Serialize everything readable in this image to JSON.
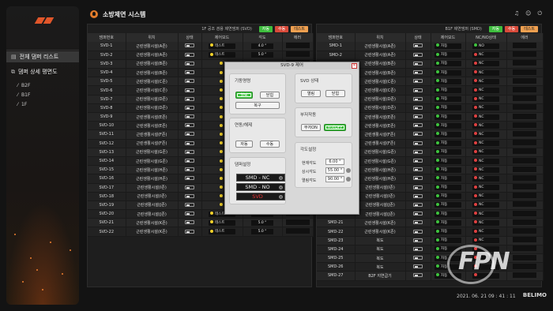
{
  "app": {
    "title": "소방제연 시스템"
  },
  "sidebar": {
    "items": [
      {
        "label": "전체 댐퍼 리스트"
      },
      {
        "label": "댐퍼 상세 평면도"
      }
    ],
    "floors": [
      "B2F",
      "B1F",
      "1F"
    ]
  },
  "left_panel": {
    "title": "1F 공조 겸용 제연댐퍼 (SVD)",
    "btn_auto": "자동",
    "btn_manual": "수동",
    "btn_test": "테스트",
    "headers": [
      "댐퍼번호",
      "위치",
      "상태",
      "제어모드",
      "각도",
      "에러"
    ],
    "rows": [
      {
        "id": "SVD-1",
        "loc": "근린생활시설(A존)",
        "mode": "테스트",
        "angle": "4.0 °"
      },
      {
        "id": "SVD-2",
        "loc": "근린생활시설(A존)",
        "mode": "테스트",
        "angle": "5.0 °"
      },
      {
        "id": "SVD-3",
        "loc": "근린생활시설(B존)",
        "mode": "",
        "angle": ""
      },
      {
        "id": "SVD-4",
        "loc": "근린생활시설(B존)",
        "mode": "",
        "angle": ""
      },
      {
        "id": "SVD-5",
        "loc": "근린생활시설(C존)",
        "mode": "",
        "angle": ""
      },
      {
        "id": "SVD-6",
        "loc": "근린생활시설(C존)",
        "mode": "",
        "angle": ""
      },
      {
        "id": "SVD-7",
        "loc": "근린생활시설(D존)",
        "mode": "",
        "angle": ""
      },
      {
        "id": "SVD-8",
        "loc": "근린생활시설(D존)",
        "mode": "",
        "angle": ""
      },
      {
        "id": "SVD-9",
        "loc": "근린생활시설(E존)",
        "mode": "",
        "angle": ""
      },
      {
        "id": "SVD-10",
        "loc": "근린생활시설(E존)",
        "mode": "",
        "angle": ""
      },
      {
        "id": "SVD-11",
        "loc": "근린생활시설(F존)",
        "mode": "",
        "angle": ""
      },
      {
        "id": "SVD-12",
        "loc": "근린생활시설(F존)",
        "mode": "",
        "angle": ""
      },
      {
        "id": "SVD-13",
        "loc": "근린생활시설(G존)",
        "mode": "",
        "angle": ""
      },
      {
        "id": "SVD-14",
        "loc": "근린생활시설(G존)",
        "mode": "",
        "angle": ""
      },
      {
        "id": "SVD-15",
        "loc": "근린생활시설(H존)",
        "mode": "",
        "angle": ""
      },
      {
        "id": "SVD-16",
        "loc": "근린생활시설(H존)",
        "mode": "",
        "angle": ""
      },
      {
        "id": "SVD-17",
        "loc": "근린생활시설(I존)",
        "mode": "",
        "angle": ""
      },
      {
        "id": "SVD-18",
        "loc": "근린생활시설(I존)",
        "mode": "",
        "angle": ""
      },
      {
        "id": "SVD-19",
        "loc": "근린생활시설(J존)",
        "mode": "",
        "angle": ""
      },
      {
        "id": "SVD-20",
        "loc": "근린생활시설(J존)",
        "mode": "테스트",
        "angle": "7.0 °"
      },
      {
        "id": "SVD-21",
        "loc": "근린생활시설(K존)",
        "mode": "테스트",
        "angle": "5.0 °"
      },
      {
        "id": "SVD-22",
        "loc": "근린생활시설(K존)",
        "mode": "테스트",
        "angle": "5.0 °"
      }
    ]
  },
  "right_panel": {
    "title": "B1F 제연댐퍼 (SMD)",
    "btn_auto": "자동",
    "btn_manual": "수동",
    "btn_test": "테스트",
    "headers": [
      "댐퍼번호",
      "위치",
      "상태",
      "제어모드",
      "NC/NO상태",
      "에러"
    ],
    "rows": [
      {
        "id": "SMD-1",
        "loc": "근린생활시설(A존)",
        "mode": "자동",
        "nc": "NO",
        "nc_color": "#3ec43e"
      },
      {
        "id": "SMD-2",
        "loc": "근린생활시설(A존)",
        "mode": "자동",
        "nc": "NC",
        "nc_color": "#e04040"
      },
      {
        "id": "SMD-3",
        "loc": "근린생활시설(B존)",
        "mode": "자동",
        "nc": "NC",
        "nc_color": "#e04040"
      },
      {
        "id": "SMD-4",
        "loc": "근린생활시설(B존)",
        "mode": "자동",
        "nc": "NC",
        "nc_color": "#e04040"
      },
      {
        "id": "SMD-5",
        "loc": "근린생활시설(C존)",
        "mode": "자동",
        "nc": "NC",
        "nc_color": "#e04040"
      },
      {
        "id": "SMD-6",
        "loc": "근린생활시설(C존)",
        "mode": "자동",
        "nc": "NC",
        "nc_color": "#e04040"
      },
      {
        "id": "SMD-7",
        "loc": "근린생활시설(D존)",
        "mode": "자동",
        "nc": "NC",
        "nc_color": "#e04040"
      },
      {
        "id": "SMD-8",
        "loc": "근린생활시설(D존)",
        "mode": "자동",
        "nc": "NC",
        "nc_color": "#e04040"
      },
      {
        "id": "SMD-9",
        "loc": "근린생활시설(E존)",
        "mode": "자동",
        "nc": "NC",
        "nc_color": "#e04040"
      },
      {
        "id": "SMD-10",
        "loc": "근린생활시설(E존)",
        "mode": "자동",
        "nc": "NC",
        "nc_color": "#e04040"
      },
      {
        "id": "SMD-11",
        "loc": "근린생활시설(F존)",
        "mode": "자동",
        "nc": "NC",
        "nc_color": "#e04040"
      },
      {
        "id": "SMD-12",
        "loc": "근린생활시설(F존)",
        "mode": "자동",
        "nc": "NC",
        "nc_color": "#e04040"
      },
      {
        "id": "SMD-13",
        "loc": "근린생활시설(G존)",
        "mode": "자동",
        "nc": "NC",
        "nc_color": "#e04040"
      },
      {
        "id": "SMD-14",
        "loc": "근린생활시설(G존)",
        "mode": "자동",
        "nc": "NC",
        "nc_color": "#e04040"
      },
      {
        "id": "SMD-15",
        "loc": "근린생활시설(H존)",
        "mode": "자동",
        "nc": "NC",
        "nc_color": "#e04040"
      },
      {
        "id": "SMD-16",
        "loc": "근린생활시설(H존)",
        "mode": "자동",
        "nc": "NC",
        "nc_color": "#e04040"
      },
      {
        "id": "SMD-17",
        "loc": "근린생활시설(I존)",
        "mode": "자동",
        "nc": "NC",
        "nc_color": "#e04040"
      },
      {
        "id": "SMD-18",
        "loc": "근린생활시설(I존)",
        "mode": "자동",
        "nc": "NC",
        "nc_color": "#e04040"
      },
      {
        "id": "SMD-19",
        "loc": "근린생활시설(J존)",
        "mode": "자동",
        "nc": "NC",
        "nc_color": "#e04040"
      },
      {
        "id": "SMD-20",
        "loc": "근린생활시설(J존)",
        "mode": "자동",
        "nc": "NC",
        "nc_color": "#e04040"
      },
      {
        "id": "SMD-21",
        "loc": "근린생활시설(K존)",
        "mode": "자동",
        "nc": "NC",
        "nc_color": "#e04040"
      },
      {
        "id": "SMD-22",
        "loc": "근린생활시설(K존)",
        "mode": "자동",
        "nc": "NC",
        "nc_color": "#e04040"
      },
      {
        "id": "SMD-23",
        "loc": "복도",
        "mode": "자동",
        "nc": "NC",
        "nc_color": "#e04040"
      },
      {
        "id": "SMD-24",
        "loc": "복도",
        "mode": "자동",
        "nc": "",
        "nc_color": "#e04040"
      },
      {
        "id": "SMD-25",
        "loc": "복도",
        "mode": "자동",
        "nc": "",
        "nc_color": "#e04040"
      },
      {
        "id": "SMD-26",
        "loc": "복도",
        "mode": "자동",
        "nc": "",
        "nc_color": "#e04040"
      },
      {
        "id": "SMD-27",
        "loc": "B2F 지연급기",
        "mode": "자동",
        "nc": "",
        "nc_color": "#e04040"
      }
    ]
  },
  "dialog": {
    "title": "SVD-9 제어",
    "func_group": "기동명령",
    "open": "열림",
    "close": "닫힘",
    "reset": "복구",
    "link_group": "연동/해제",
    "auto": "자동",
    "manual": "수동",
    "damper_group": "댐퍼설정",
    "smd_nc": "SMD - NC",
    "smd_no": "SMD - NO",
    "svd": "SVD",
    "svd_status_group": "SVD 상태",
    "st_open": "열림",
    "st_close": "닫힘",
    "buzzer_group": "부저작동",
    "buzzer_on": "부저ON",
    "buzzer_off": "부저OFF",
    "angle_group": "각도설정",
    "cur_angle_label": "현재각도",
    "cur_angle": "6.00 °",
    "open_angle_label": "상시각도",
    "open_angle": "55.00 °",
    "close_angle_label": "열림각도",
    "close_angle": "90.00 °"
  },
  "footer": {
    "datetime": "2021. 06. 21   09 : 41 : 11",
    "brand": "BELIMO"
  },
  "watermark": "FPN",
  "colors": {
    "accent": "#e07b2b",
    "green": "#3dbd3d",
    "red": "#d94a3a",
    "orange": "#f0a050"
  }
}
